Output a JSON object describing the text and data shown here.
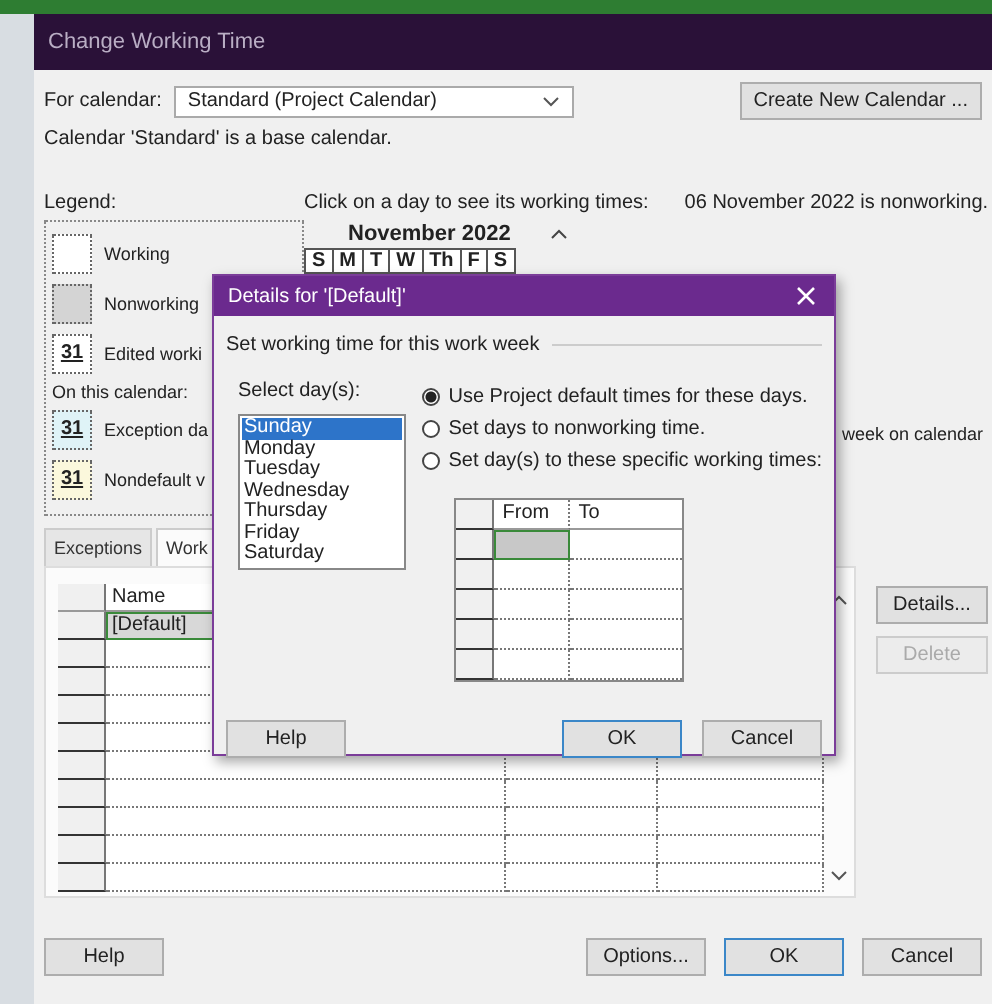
{
  "window": {
    "title": "Change Working Time"
  },
  "calendar_select": {
    "label": "For calendar:",
    "value": "Standard (Project Calendar)"
  },
  "create_button": "Create New Calendar ...",
  "base_note": "Calendar 'Standard' is a base calendar.",
  "legend": {
    "title": "Legend:",
    "items": [
      {
        "kind": "working",
        "label": "Working"
      },
      {
        "kind": "nonworking",
        "label": "Nonworking"
      },
      {
        "kind": "edited",
        "label": "Edited worki",
        "day": "31"
      }
    ],
    "section": "On this calendar:",
    "calendar_items": [
      {
        "kind": "exception",
        "label": "Exception da",
        "day": "31"
      },
      {
        "kind": "nondefault",
        "label": "Nondefault v",
        "day": "31"
      }
    ]
  },
  "calendar": {
    "prompt": "Click on a day to see its working times:",
    "status": "06 November 2022 is nonworking.",
    "month": "November 2022",
    "weekdays": [
      "S",
      "M",
      "T",
      "W",
      "Th",
      "F",
      "S"
    ]
  },
  "side_note": "week on calendar",
  "tabs": [
    {
      "label": "Exceptions",
      "selected": false
    },
    {
      "label": "Work",
      "selected": true
    }
  ],
  "table": {
    "columns": [
      "Name"
    ],
    "rows": [
      {
        "name": "[Default]",
        "selected": true
      }
    ]
  },
  "side_buttons": [
    {
      "label": "Details...",
      "disabled": false
    },
    {
      "label": "Delete",
      "disabled": true
    }
  ],
  "footer": {
    "help": "Help",
    "buttons": [
      {
        "label": "Options...",
        "default": false
      },
      {
        "label": "OK",
        "default": true
      },
      {
        "label": "Cancel",
        "default": false
      }
    ]
  },
  "details_dialog": {
    "title": "Details for '[Default]'",
    "section": "Set working time for this work week",
    "select_label": "Select day(s):",
    "days": [
      {
        "label": "Sunday",
        "selected": true
      },
      {
        "label": "Monday",
        "selected": false
      },
      {
        "label": "Tuesday",
        "selected": false
      },
      {
        "label": "Wednesday",
        "selected": false
      },
      {
        "label": "Thursday",
        "selected": false
      },
      {
        "label": "Friday",
        "selected": false
      },
      {
        "label": "Saturday",
        "selected": false
      }
    ],
    "options": [
      {
        "label": "Use Project default times for these days.",
        "selected": true
      },
      {
        "label": "Set days to nonworking time.",
        "selected": false
      },
      {
        "label": "Set day(s) to these specific working times:",
        "selected": false
      }
    ],
    "time_columns": [
      "From",
      "To"
    ],
    "buttons": [
      {
        "label": "Help",
        "default": false
      },
      {
        "label": "OK",
        "default": true
      },
      {
        "label": "Cancel",
        "default": false
      }
    ]
  }
}
